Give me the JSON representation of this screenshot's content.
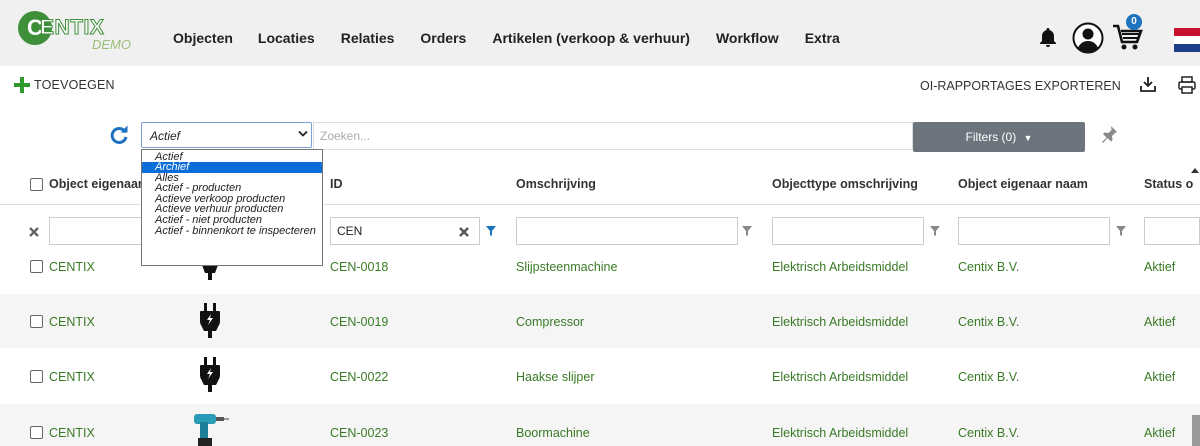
{
  "brand": {
    "logo_letter": "C",
    "name": "ENTIX",
    "sub": "DEMO"
  },
  "nav": {
    "items": [
      "Objecten",
      "Locaties",
      "Relaties",
      "Orders",
      "Artikelen (verkoop & verhuur)",
      "Workflow",
      "Extra"
    ],
    "cart_count": "0"
  },
  "toolbar": {
    "add_label": "TOEVOEGEN",
    "export_label": "OI-RAPPORTAGES EXPORTEREN"
  },
  "filters": {
    "status_value": "Actief",
    "search_placeholder": "Zoeken...",
    "filters_label": "Filters (0)",
    "status_options": [
      "Actief",
      "Archief",
      "Alles",
      "Actief - producten",
      "Actieve verkoop producten",
      "Actieve verhuur producten",
      "Actief - niet producten",
      "Actief - binnenkort te inspecteren"
    ],
    "highlighted_option_index": 1
  },
  "table": {
    "headers": [
      "Object eigenaar",
      "ID",
      "Omschrijving",
      "Objecttype omschrijving",
      "Object eigenaar naam",
      "Status o"
    ],
    "id_filter_value": "CEN",
    "rows": [
      {
        "owner": "CENTIX",
        "id": "CEN-0018",
        "description": "Slijpsteenmachine",
        "type": "Elektrisch Arbeidsmiddel",
        "owner_name": "Centix B.V.",
        "status": "Aktief",
        "image": "plug-icon"
      },
      {
        "owner": "CENTIX",
        "id": "CEN-0019",
        "description": "Compressor",
        "type": "Elektrisch Arbeidsmiddel",
        "owner_name": "Centix B.V.",
        "status": "Aktief",
        "image": "plug-icon"
      },
      {
        "owner": "CENTIX",
        "id": "CEN-0022",
        "description": "Haakse slijper",
        "type": "Elektrisch Arbeidsmiddel",
        "owner_name": "Centix B.V.",
        "status": "Aktief",
        "image": "plug-icon"
      },
      {
        "owner": "CENTIX",
        "id": "CEN-0023",
        "description": "Boormachine",
        "type": "Elektrisch Arbeidsmiddel",
        "owner_name": "Centix B.V.",
        "status": "Aktief",
        "image": "drill-icon"
      }
    ]
  },
  "colors": {
    "brand_green": "#3d8f3a",
    "link_green": "#3a7a26",
    "accent_blue": "#1e73be",
    "button_gray": "#6c757d",
    "selected_blue": "#0a6dd8"
  }
}
